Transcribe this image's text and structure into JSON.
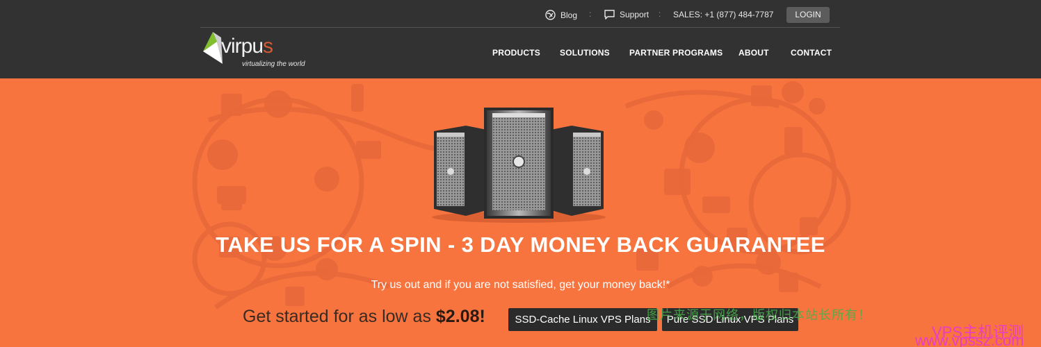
{
  "topbar": {
    "blog_label": "Blog",
    "support_label": "Support",
    "sales_label": "SALES: +1 (877) 484-7787",
    "login_label": "LOGIN",
    "separator": ":"
  },
  "logo": {
    "word_main": "virpu",
    "word_accent": "s",
    "tagline": "virtualizing the world"
  },
  "nav": {
    "products": "PRODUCTS",
    "solutions": "SOLUTIONS",
    "partner_programs": "PARTNER PROGRAMS",
    "about": "ABOUT",
    "contact": "CONTACT"
  },
  "hero": {
    "headline": "TAKE US FOR A SPIN - 3 DAY MONEY BACK GUARANTEE",
    "subline": "Try us out and if you are not satisfied, get your money back!*",
    "cta_prefix": "Get started for as low as ",
    "cta_price": "$2.08!",
    "btn_ssd_cache": "SSD-Cache Linux VPS Plans",
    "btn_pure_ssd": "Pure SSD Linux VPS Plans"
  },
  "watermarks": {
    "green": "图片来源于网络，版权归本站长所有！",
    "pink_line1": "VPS主机评测",
    "pink_line2": "www.vpssz.com"
  },
  "colors": {
    "header_bg": "#333232",
    "hero_bg": "#f7743f",
    "button_bg": "#2b2b2b",
    "logo_accent": "#d45a33"
  }
}
